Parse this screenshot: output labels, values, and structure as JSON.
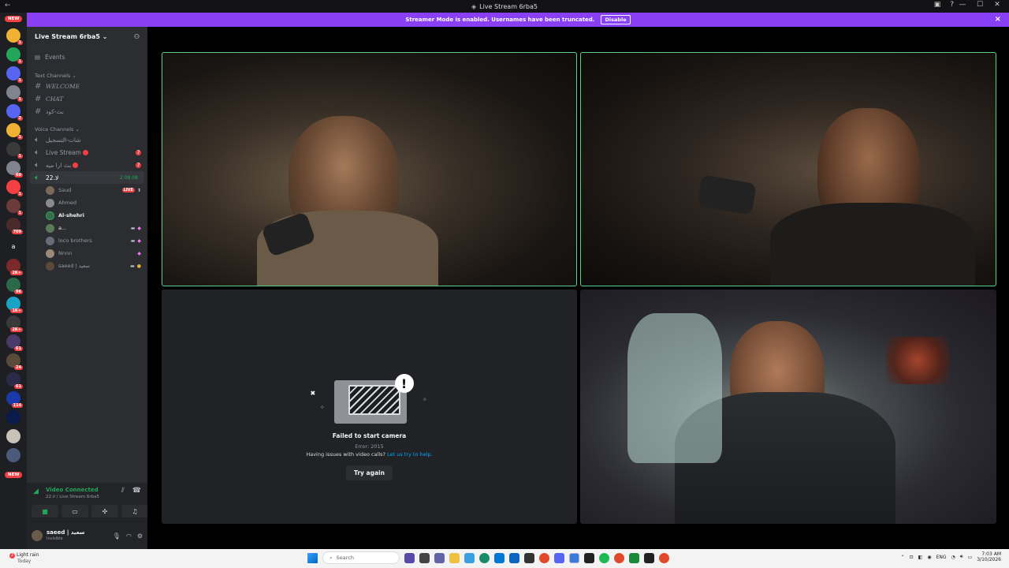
{
  "window": {
    "title": "Live Stream 6rba5"
  },
  "notice": {
    "text": "Streamer Mode is enabled. Usernames have been truncated.",
    "button": "Disable"
  },
  "guilds": {
    "new_top": "NEW",
    "new_bottom": "NEW",
    "badges": [
      "1",
      "1",
      "1",
      "1",
      "2",
      "1",
      "1",
      "60",
      "1",
      "1",
      "709",
      "2K+",
      "96",
      "1K+",
      "2K+",
      "61",
      "24",
      "61",
      "114"
    ]
  },
  "server": {
    "name": "Live Stream 6rba5",
    "events": "Events",
    "text_category": "Text Channels",
    "text_channels": [
      "WELCOME",
      "CHAT",
      "بث-كود"
    ],
    "voice_category": "Voice Channels",
    "voice_channels": [
      {
        "name": "شات-التسجيل",
        "badge": ""
      },
      {
        "name": "Live Stream",
        "badge": "7"
      },
      {
        "name": "بث ارا ميه",
        "badge": "7"
      },
      {
        "name": "2لا.2",
        "timer": "2:08:08"
      }
    ],
    "voice_users": [
      {
        "name": "Saud",
        "live": "LIVE"
      },
      {
        "name": "Ahmed"
      },
      {
        "name": "Al-shehri"
      },
      {
        "name": "a..."
      },
      {
        "name": "loco brothers"
      },
      {
        "name": "Nnnn"
      },
      {
        "name": "saeed | سعيد"
      }
    ]
  },
  "voice_panel": {
    "status": "Video Connected",
    "channel": "2لا.2 / Live Stream 6rba5"
  },
  "user": {
    "name": "saeed | سعيد",
    "status": "Invisible"
  },
  "camera_error": {
    "title": "Failed to start camera",
    "code": "Error: 2015",
    "help_text": "Having issues with video calls?",
    "help_link": "Let us try to help.",
    "retry": "Try again"
  },
  "taskbar": {
    "weather_badge": "2",
    "weather": "Light rain",
    "weather_sub": "Today",
    "search": "Search",
    "lang": "ENG",
    "time": "7:03 AM",
    "date": "3/10/2026"
  },
  "colors": {
    "brand": "#5865f2",
    "notice": "#8940f5",
    "speaking": "#5fd08a",
    "online": "#23a55a",
    "danger": "#f23f43"
  }
}
